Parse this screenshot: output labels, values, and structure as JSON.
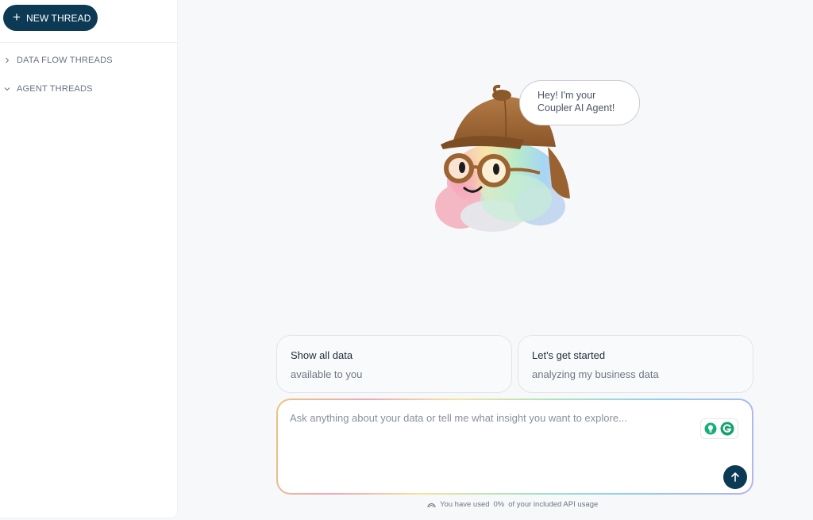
{
  "sidebar": {
    "new_thread_label": "NEW THREAD",
    "items": [
      {
        "label": "DATA FLOW THREADS",
        "state": "collapsed"
      },
      {
        "label": "AGENT THREADS",
        "state": "expanded"
      }
    ]
  },
  "mascot": {
    "bubble_line1": "Hey! I'm your",
    "bubble_line2": "Coupler AI Agent!"
  },
  "suggestions": [
    {
      "title": "Show all data",
      "subtitle": "available to you"
    },
    {
      "title": "Let's get started",
      "subtitle": "analyzing my business data"
    }
  ],
  "composer": {
    "placeholder": "Ask anything about your data or tell me what insight you want to explore...",
    "value": ""
  },
  "usage": {
    "prefix": "You have used",
    "percent": "0%",
    "suffix": "of your included API usage"
  },
  "colors": {
    "primary": "#0c3a55",
    "background": "#f7f8fa",
    "sidebar": "#ffffff"
  }
}
